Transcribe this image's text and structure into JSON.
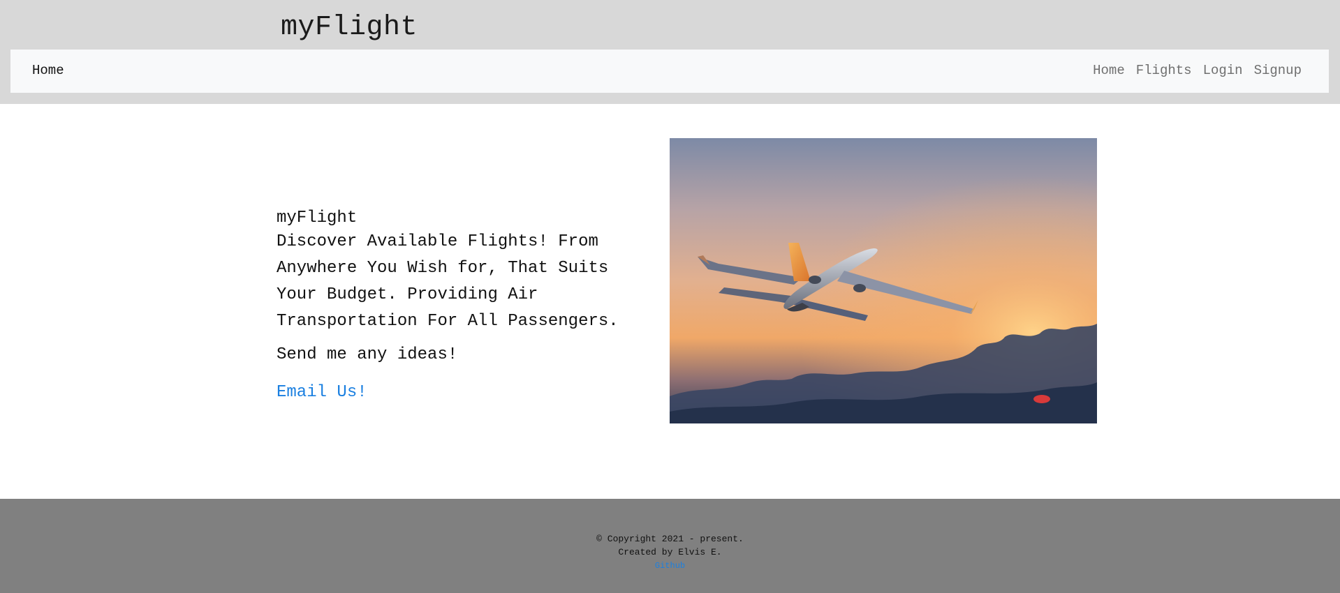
{
  "header": {
    "site_title": "myFlight"
  },
  "navbar": {
    "brand": "Home",
    "links": [
      "Home",
      "Flights",
      "Login",
      "Signup"
    ]
  },
  "hero": {
    "heading": "myFlight",
    "description": "Discover Available Flights! From Anywhere You Wish for, That Suits Your Budget. Providing Air Transportation For All Passengers.",
    "cta_text": "Send me any ideas!",
    "email_link": "Email Us!",
    "image_icon": "airplane-sunset-photo"
  },
  "footer": {
    "copyright": "© Copyright 2021 - present.",
    "created_by": "Created by Elvis E.",
    "github_link": "Github"
  },
  "colors": {
    "header_band": "#d8d8d8",
    "navbar_bg": "#f8f9fa",
    "link_blue": "#1a7fe0",
    "footer_bg": "#808080"
  }
}
